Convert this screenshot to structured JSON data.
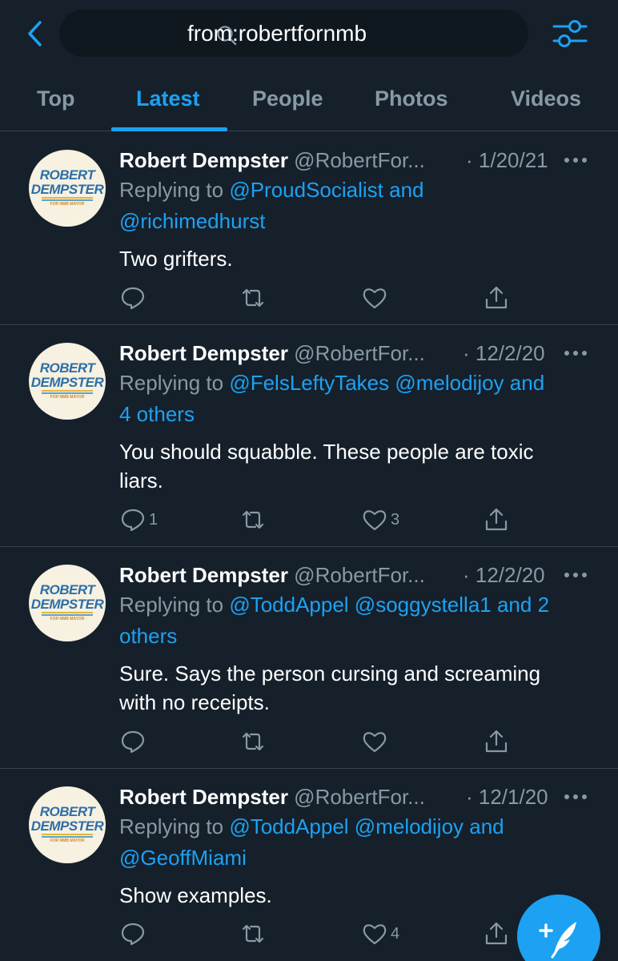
{
  "search": {
    "query": "from:robertfornmb"
  },
  "tabs": [
    {
      "label": "Top"
    },
    {
      "label": "Latest"
    },
    {
      "label": "People"
    },
    {
      "label": "Photos"
    },
    {
      "label": "Videos"
    }
  ],
  "avatar": {
    "line1": "ROBERT",
    "line2": "DEMPSTER",
    "tag": "FOR NMB MAYOR"
  },
  "tweets": [
    {
      "name": "Robert Dempster",
      "handle": "@RobertFor...",
      "date": "· 1/20/21",
      "replying_prefix": "Replying to ",
      "mentions_line1": "@ProudSocialist and",
      "mentions_line2": "@richimedhurst",
      "text_line1": "Two grifters.",
      "text_line2": "",
      "reply_count": "",
      "like_count": ""
    },
    {
      "name": "Robert Dempster",
      "handle": "@RobertFor...",
      "date": "· 12/2/20",
      "replying_prefix": "Replying to ",
      "mentions_line1": "@FelsLeftyTakes @melodijoy and",
      "mentions_line2": "4 others",
      "text_line1": "You should squabble. These people are toxic",
      "text_line2": "liars.",
      "reply_count": "1",
      "like_count": "3"
    },
    {
      "name": "Robert Dempster",
      "handle": "@RobertFor...",
      "date": "· 12/2/20",
      "replying_prefix": "Replying to ",
      "mentions_line1": "@ToddAppel @soggystella1 and 2",
      "mentions_line2": "others",
      "text_line1": "Sure. Says the person cursing and screaming",
      "text_line2": "with no receipts.",
      "reply_count": "",
      "like_count": ""
    },
    {
      "name": "Robert Dempster",
      "handle": "@RobertFor...",
      "date": "· 12/1/20",
      "replying_prefix": "Replying to ",
      "mentions_line1": "@ToddAppel @melodijoy and",
      "mentions_line2": "@GeoffMiami",
      "text_line1": "Show examples.",
      "text_line2": "",
      "reply_count": "",
      "like_count": "4"
    }
  ],
  "colors": {
    "background": "#15202b",
    "accent": "#1da1f2",
    "muted": "#8899a6",
    "divider": "#38444d"
  },
  "icons": {
    "back": "chevron-left-icon",
    "search": "search-icon",
    "filter": "sliders-icon",
    "reply": "comment-icon",
    "retweet": "retweet-icon",
    "like": "heart-icon",
    "share": "share-icon",
    "more": "more-icon",
    "compose": "compose-feather-icon"
  }
}
